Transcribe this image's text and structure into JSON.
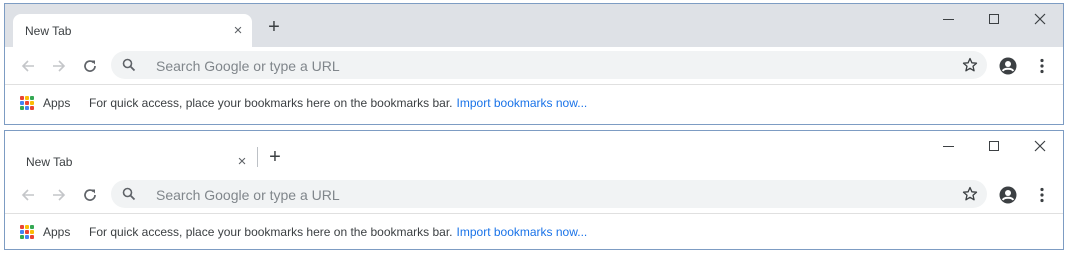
{
  "windows": [
    {
      "tab": {
        "title": "New Tab",
        "close": "×"
      },
      "new_tab": "+",
      "controls": {
        "close": "✕"
      },
      "nav": {
        "back": "←",
        "forward": "→",
        "reload": "C"
      },
      "omnibox": {
        "placeholder": "Search Google or type a URL"
      },
      "bookmarks": {
        "apps_label": "Apps",
        "hint": "For quick access, place your bookmarks here on the bookmarks bar.",
        "import_link": "Import bookmarks now..."
      }
    },
    {
      "tab": {
        "title": "New Tab",
        "close": "×"
      },
      "new_tab": "+",
      "controls": {
        "close": "✕"
      },
      "nav": {
        "back": "←",
        "forward": "→",
        "reload": "C"
      },
      "omnibox": {
        "placeholder": "Search Google or type a URL"
      },
      "bookmarks": {
        "apps_label": "Apps",
        "hint": "For quick access, place your bookmarks here on the bookmarks bar.",
        "import_link": "Import bookmarks now..."
      }
    }
  ],
  "colors": {
    "window_border": "#7d9cc3",
    "tabstrip_bg": "#dee1e6",
    "omnibox_bg": "#f1f3f4",
    "link": "#1a73e8",
    "apps_grid": [
      "#ea4335",
      "#fbbc04",
      "#34a853",
      "#4285f4",
      "#ea4335",
      "#fbbc04",
      "#34a853",
      "#4285f4",
      "#ea4335"
    ]
  }
}
